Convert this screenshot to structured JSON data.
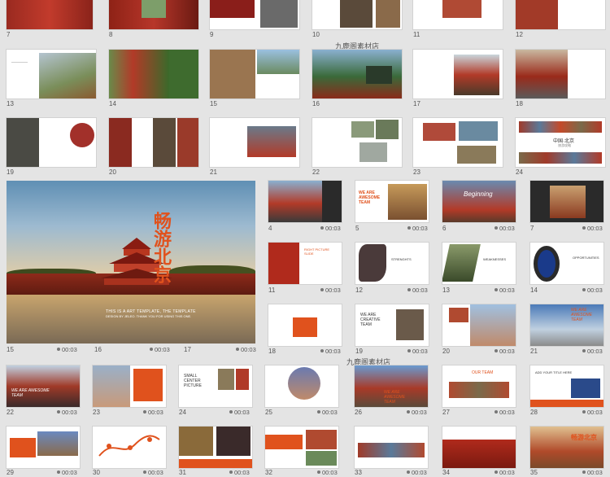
{
  "watermark": "九鹿阁素材店",
  "main_slide": {
    "title": "畅游北京",
    "subtitle_line1": "THIS IS A ART TEMPLATE, THE TEMPLATE",
    "subtitle_line2": "DESIGN BY JELEO. THANK YOU FOR USING THIS ONE."
  },
  "top_rows": [
    {
      "nums": [
        "7",
        "8",
        "9",
        "10",
        "11",
        "12"
      ]
    },
    {
      "nums": [
        "13",
        "14",
        "15",
        "16",
        "17",
        "18"
      ]
    },
    {
      "nums": [
        "19",
        "20",
        "21",
        "22",
        "23",
        "24"
      ]
    }
  ],
  "main_row": {
    "num_a": "15",
    "dur_a": "00:03",
    "num_b": "16",
    "dur_b": "00:03",
    "num_c": "17",
    "dur_c": "00:03"
  },
  "right_grid": [
    {
      "num": "4",
      "dur": "00:03"
    },
    {
      "num": "5",
      "dur": "00:03"
    },
    {
      "num": "6",
      "dur": "00:03"
    },
    {
      "num": "7",
      "dur": "00:03"
    },
    {
      "num": "11",
      "dur": "00:03"
    },
    {
      "num": "12",
      "dur": "00:03"
    },
    {
      "num": "13",
      "dur": "00:03"
    },
    {
      "num": "14",
      "dur": "00:03"
    },
    {
      "num": "18",
      "dur": "00:03"
    },
    {
      "num": "19",
      "dur": "00:03"
    },
    {
      "num": "20",
      "dur": "00:03"
    },
    {
      "num": "21",
      "dur": "00:03"
    }
  ],
  "bottom_rows": [
    [
      {
        "num": "22",
        "dur": "00:03"
      },
      {
        "num": "23",
        "dur": "00:03"
      },
      {
        "num": "24",
        "dur": "00:03"
      },
      {
        "num": "25",
        "dur": "00:03"
      },
      {
        "num": "26",
        "dur": "00:03"
      },
      {
        "num": "27",
        "dur": "00:03"
      },
      {
        "num": "28",
        "dur": "00:03"
      }
    ],
    [
      {
        "num": "29",
        "dur": "00:03"
      },
      {
        "num": "30",
        "dur": "00:03"
      },
      {
        "num": "31",
        "dur": "00:03"
      },
      {
        "num": "32",
        "dur": "00:03"
      },
      {
        "num": "33",
        "dur": "00:03"
      },
      {
        "num": "34",
        "dur": "00:03"
      },
      {
        "num": "35",
        "dur": "00:03"
      }
    ]
  ],
  "slide_texts": {
    "s16_label": "畅游北京",
    "s24_title": "中国·北京",
    "s24_sub": "旅游攻略",
    "s5_text": "WE ARE AWESOME TEAM",
    "s6_text": "Beginning",
    "s11_text": "RIGHT PICTURE SLIDE",
    "s12_text": "STRENGHTS",
    "s13_text": "WEAKNESSES",
    "s14_text": "OPPORTUNITIES",
    "s19_text": "WE ARE CREATIVE TEAM",
    "s21_text": "WE ARE AWESOME TEAM",
    "s22_text": "WE ARE AWESOME TEAM",
    "s24b_text": "SMALL CENTER PICTURE",
    "s26_text": "WE ARE AWESOME TEAM",
    "s27_text": "OUR TEAM",
    "s28_text": "ADD YOUR TITLE HERE",
    "s35_text": "畅游北京"
  },
  "colors": {
    "accent": "#e0521d",
    "red": "#b02a1c",
    "bg": "#e4e4e4"
  }
}
